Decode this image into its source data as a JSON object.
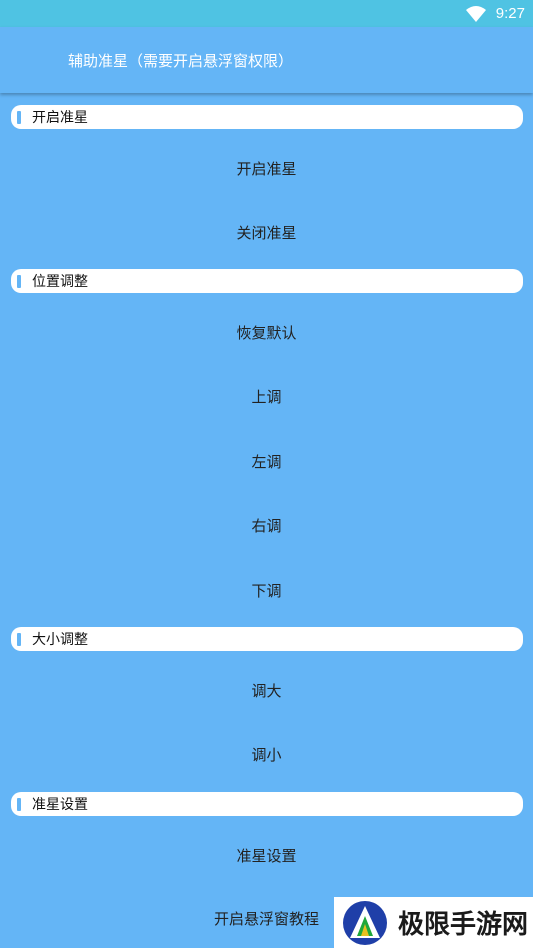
{
  "status_bar": {
    "time": "9:27",
    "wifi_icon": "wifi-icon"
  },
  "app_bar": {
    "title": "辅助准星（需要开启悬浮窗权限）"
  },
  "sections": [
    {
      "header": "开启准星",
      "items": [
        "开启准星",
        "关闭准星"
      ]
    },
    {
      "header": "位置调整",
      "items": [
        "恢复默认",
        "上调",
        "左调",
        "右调",
        "下调"
      ]
    },
    {
      "header": "大小调整",
      "items": [
        "调大",
        "调小"
      ]
    },
    {
      "header": "准星设置",
      "items": [
        "准星设置",
        "开启悬浮窗教程"
      ]
    }
  ],
  "watermark": {
    "text": "极限手游网"
  },
  "colors": {
    "background": "#64b5f6",
    "status_bar": "#4fc3e3",
    "header_bg": "#ffffff"
  }
}
